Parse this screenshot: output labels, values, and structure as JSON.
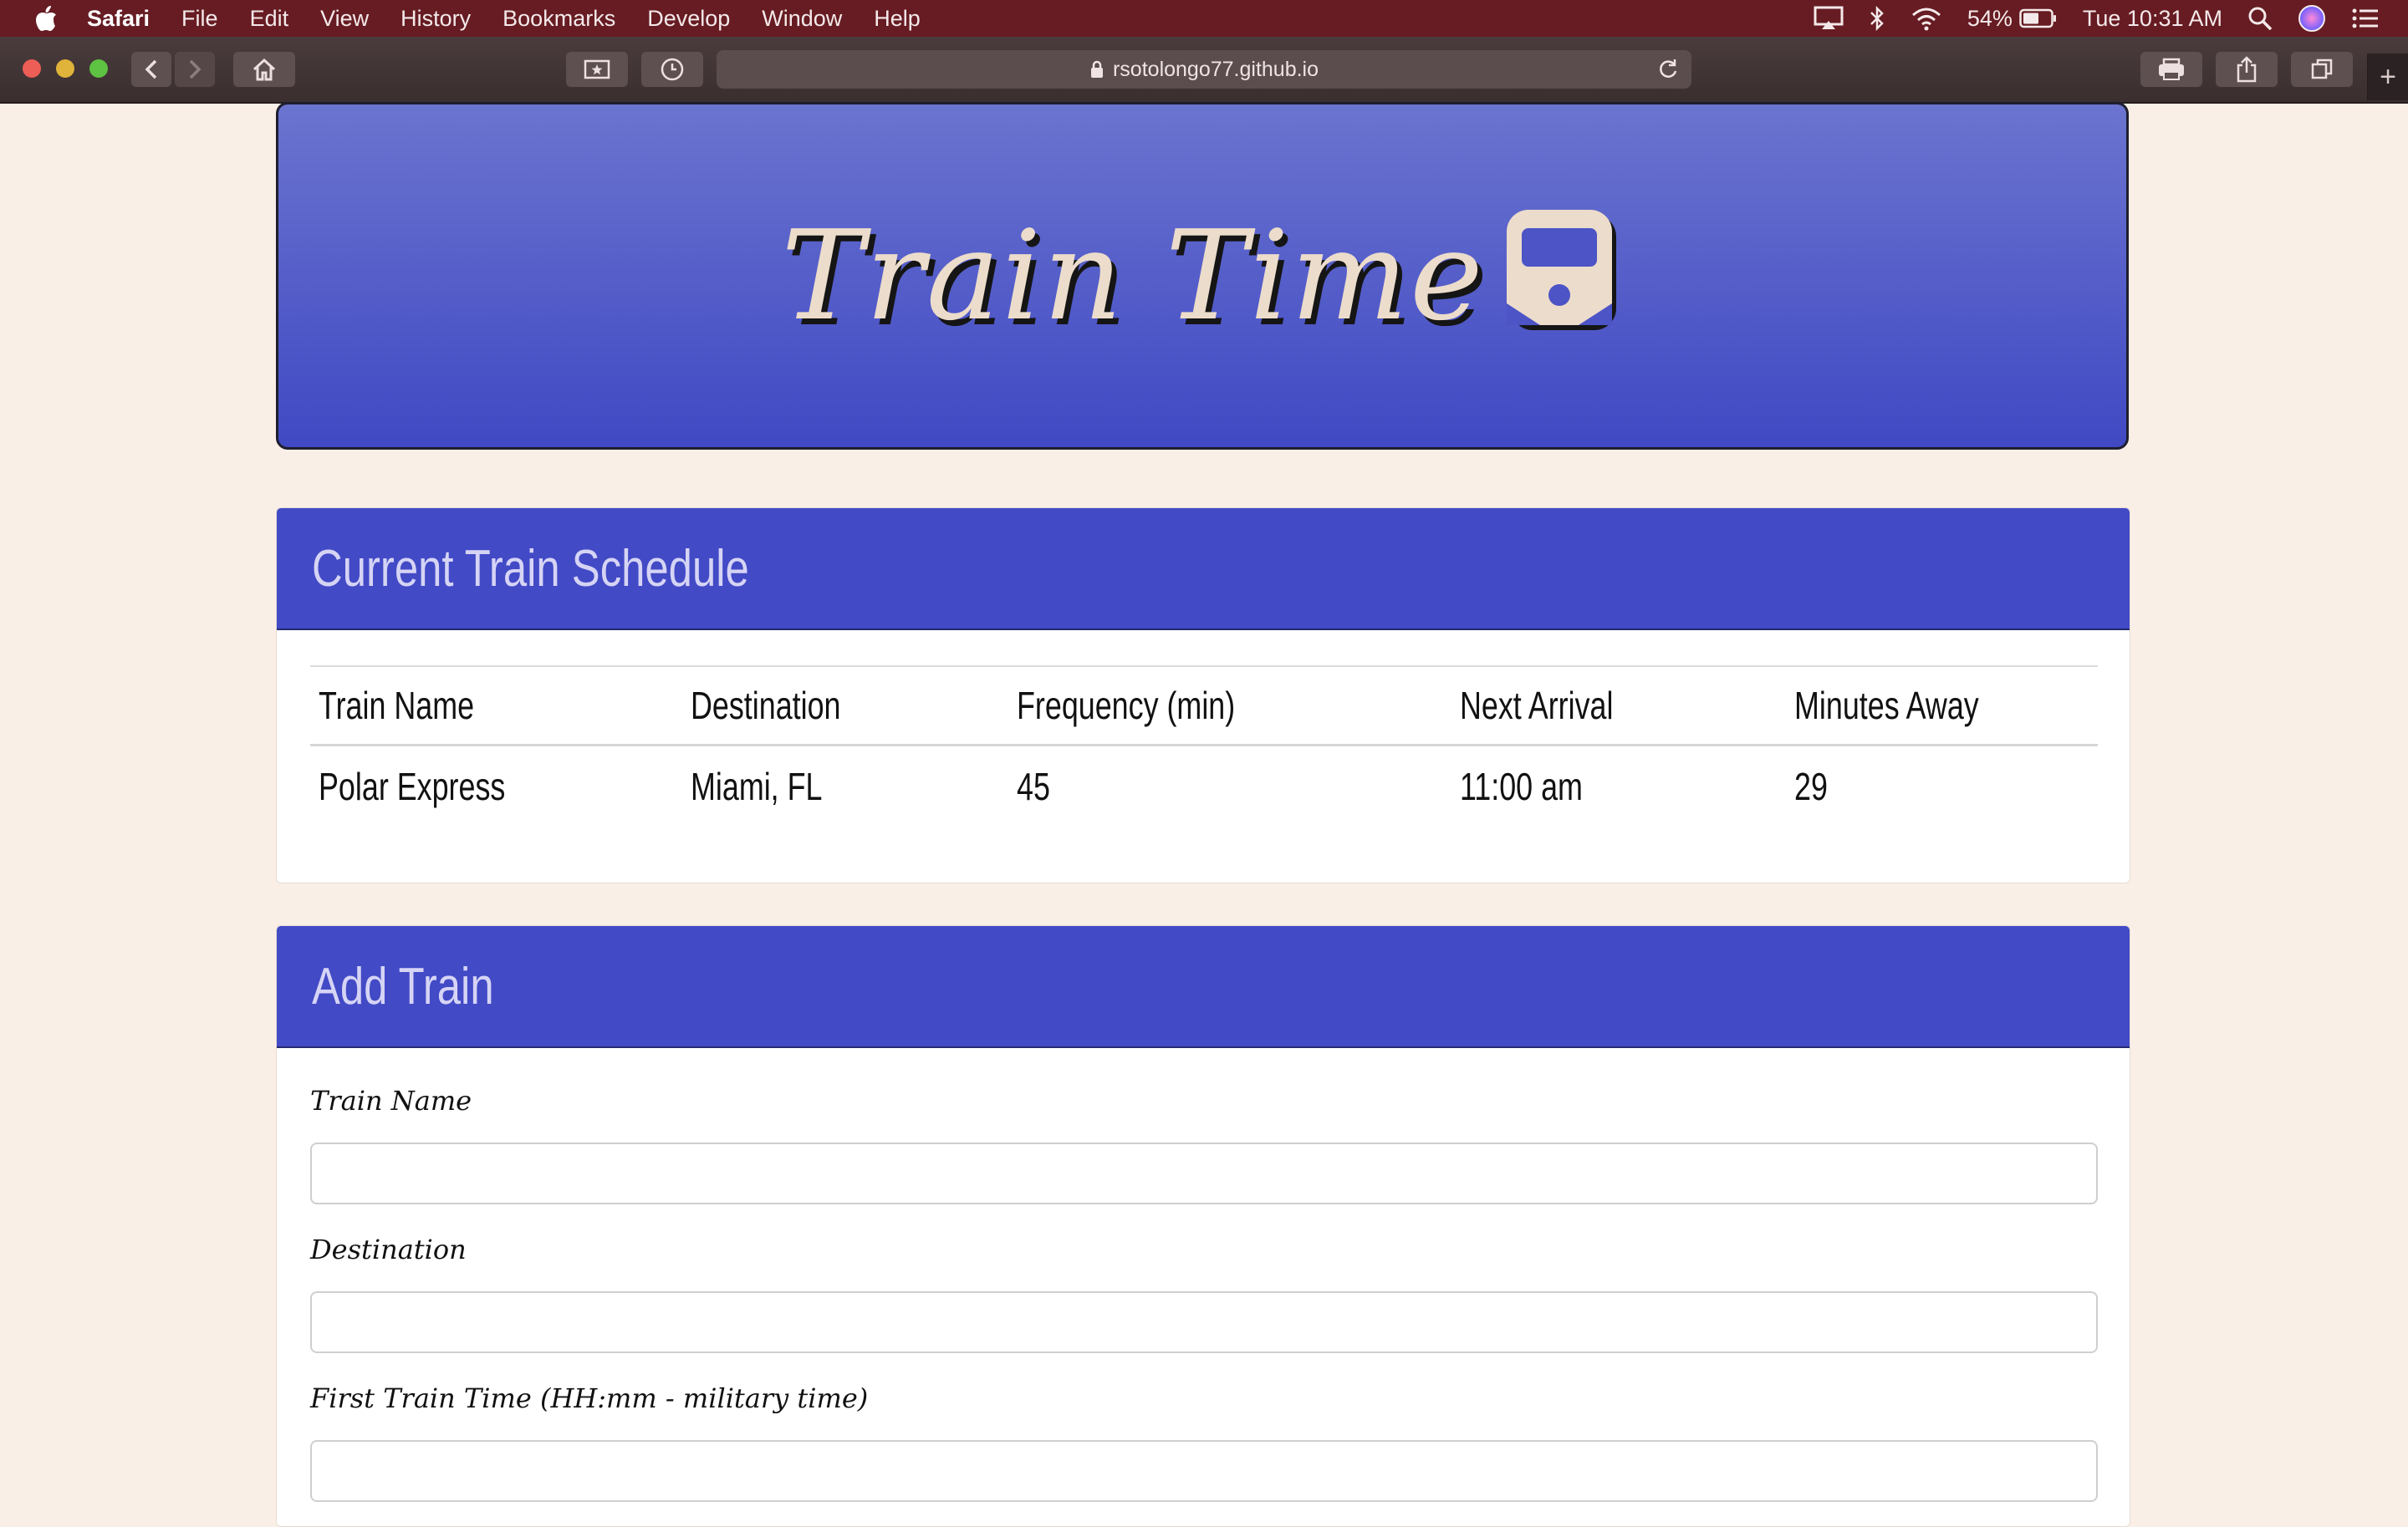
{
  "menubar": {
    "app_name": "Safari",
    "items": [
      "File",
      "Edit",
      "View",
      "History",
      "Bookmarks",
      "Develop",
      "Window",
      "Help"
    ],
    "battery_percent": "54%",
    "clock": "Tue 10:31 AM"
  },
  "browser": {
    "url": "rsotolongo77.github.io",
    "new_tab_label": "+"
  },
  "header": {
    "title": "Train Time",
    "title_color": "#ecdccb",
    "background": "#4d55c8"
  },
  "schedule": {
    "title": "Current Train Schedule",
    "columns": [
      "Train Name",
      "Destination",
      "Frequency (min)",
      "Next Arrival",
      "Minutes Away"
    ],
    "rows": [
      [
        "Polar Express",
        "Miami, FL",
        "45",
        "11:00 am",
        "29"
      ]
    ]
  },
  "add_train": {
    "title": "Add Train",
    "fields": [
      {
        "label": "Train Name",
        "value": ""
      },
      {
        "label": "Destination",
        "value": ""
      },
      {
        "label": "First Train Time (HH:mm - military time)",
        "value": ""
      }
    ]
  },
  "colors": {
    "menubar": "#661c22",
    "page_background": "#faefe6",
    "panel_header": "#424ac6"
  }
}
